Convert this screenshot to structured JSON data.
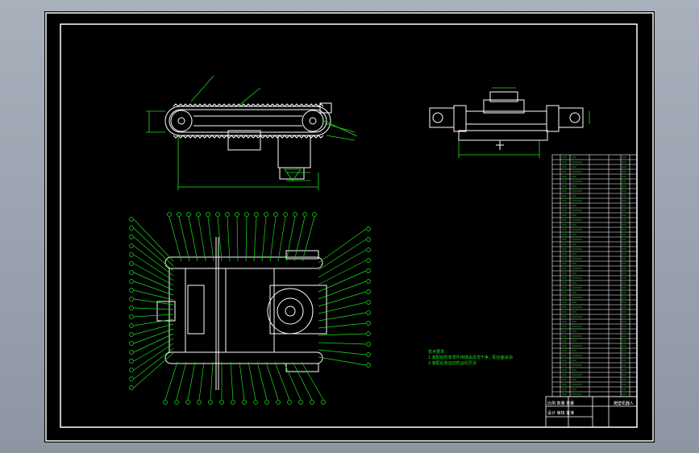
{
  "drawing": {
    "notes": {
      "heading": "技术要求",
      "line1": "1.装配前所有零件用煤油清洗干净，配合面涂油",
      "line2": "2.装配后各运动件运动灵活"
    },
    "title_block": {
      "drawing_title": "爬壁机器人",
      "scale_row": "比例  数量  重量",
      "signoff_row": "设计  审核  批准"
    },
    "bom": {
      "rows": 50
    },
    "balloons": {
      "top_count": 16,
      "bottom_count": 15,
      "left_count": 20,
      "right_count": 14
    }
  },
  "colors": {
    "frame": "#ffffff",
    "line": "#ffffff",
    "annotation": "#18e018",
    "dimension": "#18e018",
    "background": "#000000"
  }
}
